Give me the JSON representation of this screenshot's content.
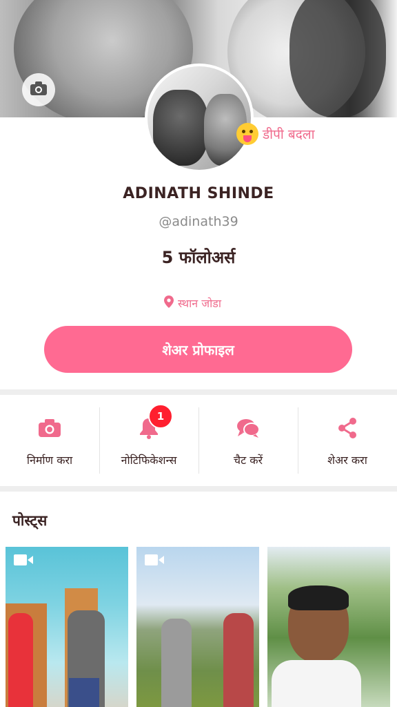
{
  "profile": {
    "name": "ADINATH SHINDE",
    "handle": "@adinath39",
    "followers": "5 फॉलोअर्स",
    "change_dp_label": "डीपी बदला",
    "location_label": "स्थान जोडा",
    "share_profile_label": "शेअर प्रोफाइल"
  },
  "actions": [
    {
      "label": "निर्माण करा",
      "icon": "camera-icon"
    },
    {
      "label": "नोटिफिकेशन्स",
      "icon": "bell-icon",
      "badge": "1"
    },
    {
      "label": "चैट करें",
      "icon": "chat-icon"
    },
    {
      "label": "शेअर करा",
      "icon": "share-icon"
    }
  ],
  "posts": {
    "title": "पोस्ट्स",
    "items": [
      {
        "type": "video",
        "icon": "video-icon"
      },
      {
        "type": "video",
        "icon": "video-icon"
      },
      {
        "type": "image"
      }
    ]
  },
  "colors": {
    "accent": "#ff6a92",
    "accent_text": "#f06a8c",
    "badge": "#ff1f2f",
    "dark_text": "#3b2323"
  }
}
